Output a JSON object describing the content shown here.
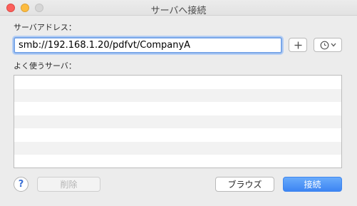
{
  "window": {
    "title": "サーバへ接続"
  },
  "address": {
    "label": "サーバアドレス：",
    "value": "smb://192.168.1.20/pdfvt/CompanyA"
  },
  "favorites": {
    "label": "よく使うサーバ：",
    "rows": [
      "",
      "",
      "",
      "",
      "",
      "",
      ""
    ]
  },
  "buttons": {
    "help": "?",
    "delete": "削除",
    "browse": "ブラウズ",
    "connect": "接続"
  },
  "icons": {
    "add": "plus-icon",
    "recent": "clock-icon",
    "menu": "chevron-down-icon"
  },
  "colors": {
    "accent": "#3d85f3",
    "focus_ring": "#7aa7e8"
  }
}
